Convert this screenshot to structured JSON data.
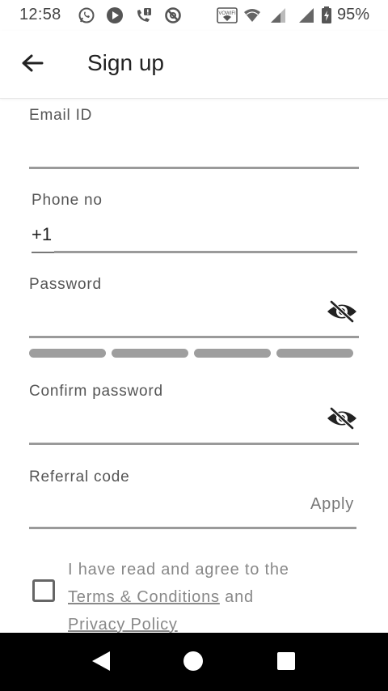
{
  "status_bar": {
    "time": "12:58",
    "battery_percent": "95%",
    "left_icons": [
      "whatsapp-icon",
      "media-icon",
      "missed-call-icon",
      "blocked-icon"
    ],
    "right_icons": [
      "vowifi-icon",
      "wifi-icon",
      "signal-icon",
      "signal-icon-2",
      "battery-charging-icon"
    ],
    "vowifi_label": "VOWIFI"
  },
  "app_bar": {
    "title": "Sign up",
    "back_icon": "arrow-back-icon"
  },
  "form": {
    "email": {
      "label": "Email ID",
      "value": ""
    },
    "phone": {
      "label": "Phone no",
      "country_code": "+1",
      "value": ""
    },
    "password": {
      "label": "Password",
      "value": "",
      "visibility_icon": "eye-off-icon",
      "strength_segments": 4,
      "strength_level": 0
    },
    "confirm_password": {
      "label": "Confirm password",
      "value": "",
      "visibility_icon": "eye-off-icon"
    },
    "referral": {
      "label": "Referral code",
      "value": "",
      "apply_label": "Apply"
    },
    "agreement": {
      "checked": false,
      "prefix": "I have read and agree to the",
      "terms_link": "Terms & Conditions",
      "conjunction": "and",
      "privacy_link": "Privacy Policy"
    }
  },
  "nav_bar": {
    "icons": [
      "nav-back-icon",
      "nav-home-icon",
      "nav-recents-icon"
    ]
  },
  "colors": {
    "underline": "#9a9a9a",
    "label": "#555555",
    "strength_bar": "#9e9e9e",
    "nav_bar": "#000000"
  }
}
